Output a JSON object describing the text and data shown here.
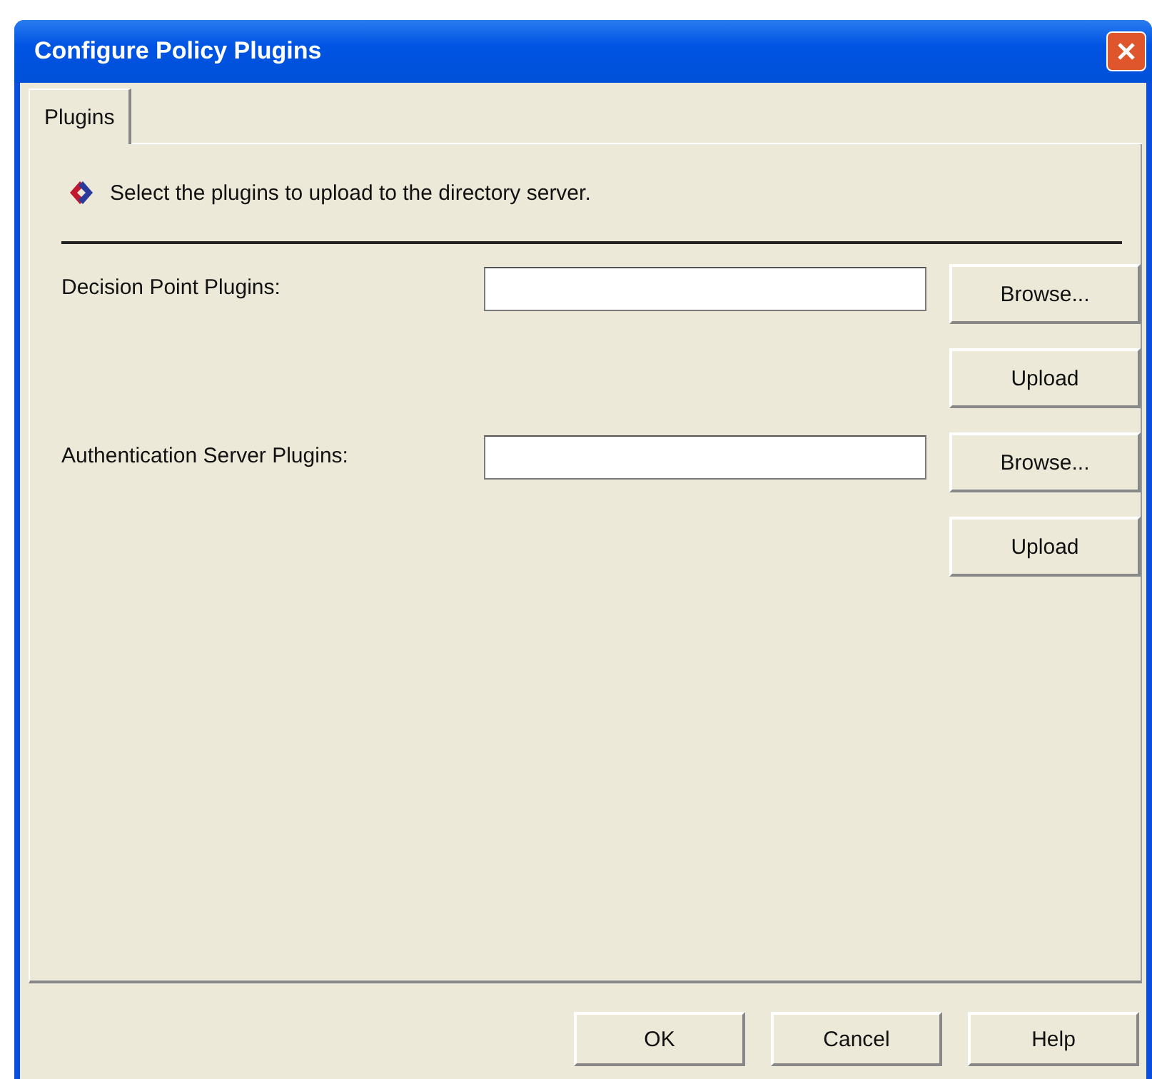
{
  "window": {
    "title": "Configure Policy Plugins"
  },
  "tabs": [
    {
      "label": "Plugins",
      "selected": true
    }
  ],
  "instruction": "Select the plugins to upload to the directory server.",
  "rows": [
    {
      "label": "Decision Point Plugins:",
      "browse": "Browse...",
      "upload": "Upload"
    },
    {
      "label": "Authentication Server Plugins:",
      "browse": "Browse...",
      "upload": "Upload"
    }
  ],
  "buttons": [
    "OK",
    "Cancel",
    "Help"
  ]
}
